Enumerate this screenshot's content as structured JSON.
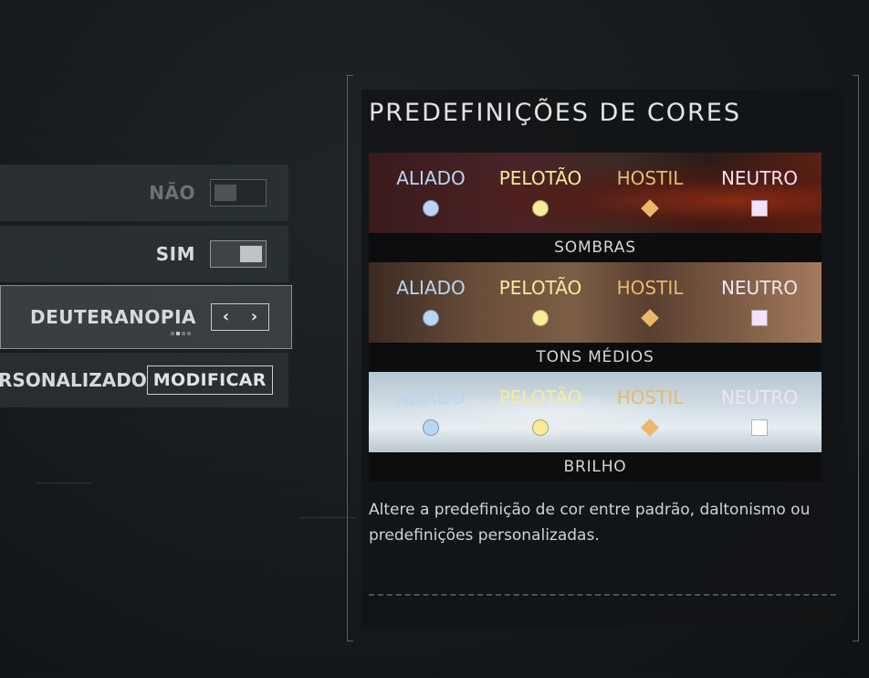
{
  "options": {
    "row1": {
      "value": "NÃO",
      "toggle": "off"
    },
    "row2": {
      "value": "SIM",
      "toggle": "on"
    },
    "row3": {
      "value": "DEUTERANOPIA",
      "prev": "‹",
      "next": "›",
      "page_dots": 4,
      "active_dot": 1
    },
    "row4": {
      "label": "RSONALIZADO",
      "button": "MODIFICAR"
    }
  },
  "panel": {
    "title": "PREDEFINIÇÕES DE CORES",
    "presets": [
      {
        "caption": "SOMBRAS",
        "background": "dark-red"
      },
      {
        "caption": "TONS MÉDIOS",
        "background": "mid-brown"
      },
      {
        "caption": "BRILHO",
        "background": "snow-white"
      }
    ],
    "factions": [
      {
        "label": "ALIADO",
        "color": "#b9d6f5",
        "shape": "circle"
      },
      {
        "label": "PELOTÃO",
        "color": "#f6ec9a",
        "shape": "circle"
      },
      {
        "label": "HOSTIL",
        "color": "#e9b86a",
        "shape": "diamond"
      },
      {
        "label": "NEUTRO",
        "color": "#f3e2f8",
        "shape": "square"
      }
    ],
    "description": "Altere a predefinição de cor entre padrão, daltonismo ou predefinições personalizadas."
  }
}
